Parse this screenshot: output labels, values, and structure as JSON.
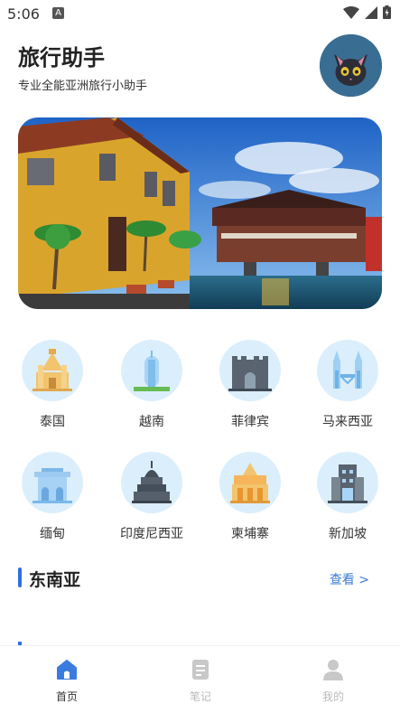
{
  "status_bar": {
    "time": "5:06",
    "badge": "A",
    "icons": [
      "wifi-icon",
      "signal-icon",
      "battery-icon"
    ]
  },
  "header": {
    "title": "旅行助手",
    "subtitle": "专业全能亚洲旅行小助手"
  },
  "countries": [
    {
      "label": "泰国",
      "icon": "thailand-temple-icon"
    },
    {
      "label": "越南",
      "icon": "vietnam-monument-icon"
    },
    {
      "label": "菲律宾",
      "icon": "philippines-fort-icon"
    },
    {
      "label": "马来西亚",
      "icon": "malaysia-towers-icon"
    },
    {
      "label": "缅甸",
      "icon": "myanmar-palace-icon"
    },
    {
      "label": "印度尼西亚",
      "icon": "indonesia-stupa-icon"
    },
    {
      "label": "柬埔寨",
      "icon": "cambodia-palace-icon"
    },
    {
      "label": "新加坡",
      "icon": "singapore-building-icon"
    }
  ],
  "section": {
    "title": "东南亚",
    "more": "查看 >"
  },
  "tabbar": {
    "tabs": [
      {
        "label": "首页",
        "icon": "home-icon",
        "active": true
      },
      {
        "label": "笔记",
        "icon": "notes-icon",
        "active": false
      },
      {
        "label": "我的",
        "icon": "profile-icon",
        "active": false
      }
    ]
  },
  "colors": {
    "accent": "#2f6fe0",
    "link": "#3a7bd5",
    "icon_bg": "#dbeefc"
  }
}
